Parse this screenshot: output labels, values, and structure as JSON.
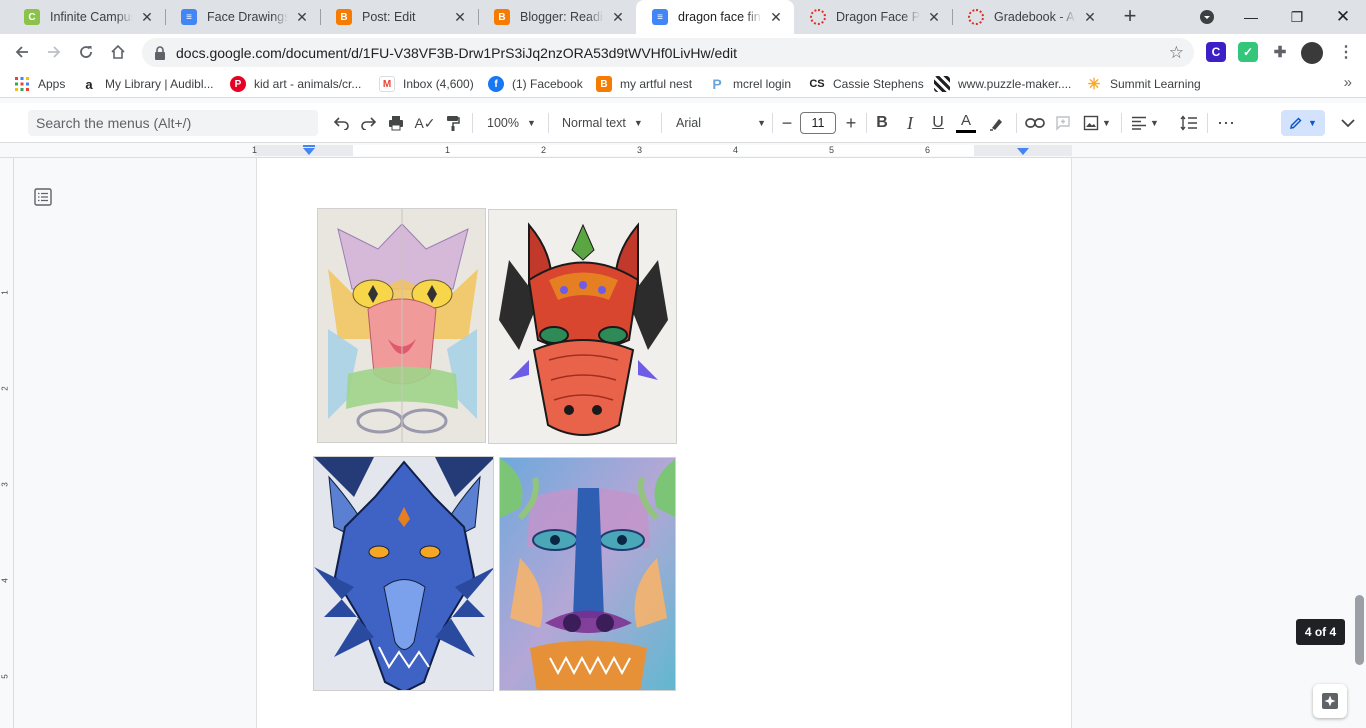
{
  "browser": {
    "tabs": [
      {
        "title": "Infinite Campus",
        "icon": "campus-icon",
        "color": "#8bc34a",
        "active": false
      },
      {
        "title": "Face Drawings - G",
        "icon": "docs-icon",
        "color": "#4285f4",
        "active": false
      },
      {
        "title": "Post: Edit",
        "icon": "blogger-icon",
        "color": "#f57c00",
        "active": false
      },
      {
        "title": "Blogger: Reading",
        "icon": "blogger-icon",
        "color": "#f57c00",
        "active": false
      },
      {
        "title": "dragon face finish",
        "icon": "docs-icon",
        "color": "#4285f4",
        "active": true
      },
      {
        "title": "Dragon Face Proj",
        "icon": "loading-icon",
        "color": "#d93025",
        "active": false
      },
      {
        "title": "Gradebook - Art",
        "icon": "loading-icon",
        "color": "#d93025",
        "active": false
      }
    ],
    "url": "docs.google.com/document/d/1FU-V38VF3B-Drw1PrS3iJq2nzORA53d9tWVHf0LivHw/edit",
    "bookmarks": [
      {
        "label": "Apps",
        "icon": "apps-grid-icon",
        "color": "#ea4335"
      },
      {
        "label": "My Library | Audibl...",
        "icon": "amazon-icon",
        "color": "#ff9900"
      },
      {
        "label": "kid art - animals/cr...",
        "icon": "pinterest-icon",
        "color": "#e60023"
      },
      {
        "label": "Inbox (4,600)",
        "icon": "gmail-icon",
        "color": "#ea4335"
      },
      {
        "label": "(1) Facebook",
        "icon": "facebook-icon",
        "color": "#1877f2"
      },
      {
        "label": "my artful nest",
        "icon": "blogger-icon",
        "color": "#f57c00"
      },
      {
        "label": "mcrel login",
        "icon": "mcrel-icon",
        "color": "#6aa7d8"
      },
      {
        "label": "Cassie Stephens",
        "icon": "cs-icon",
        "color": "#202124"
      },
      {
        "label": "www.puzzle-maker....",
        "icon": "puzzle-icon",
        "color": "#202124"
      },
      {
        "label": "Summit Learning",
        "icon": "summit-icon",
        "color": "#f9a825"
      }
    ]
  },
  "docs": {
    "menu_search_placeholder": "Search the menus (Alt+/)",
    "zoom": "100%",
    "style": "Normal text",
    "font": "Arial",
    "font_size": "11",
    "ruler_numbers": [
      "1",
      "1",
      "2",
      "3",
      "4",
      "5",
      "6"
    ],
    "vruler_numbers": [
      "1",
      "2",
      "3",
      "4",
      "5"
    ],
    "page_count": "4 of 4"
  }
}
